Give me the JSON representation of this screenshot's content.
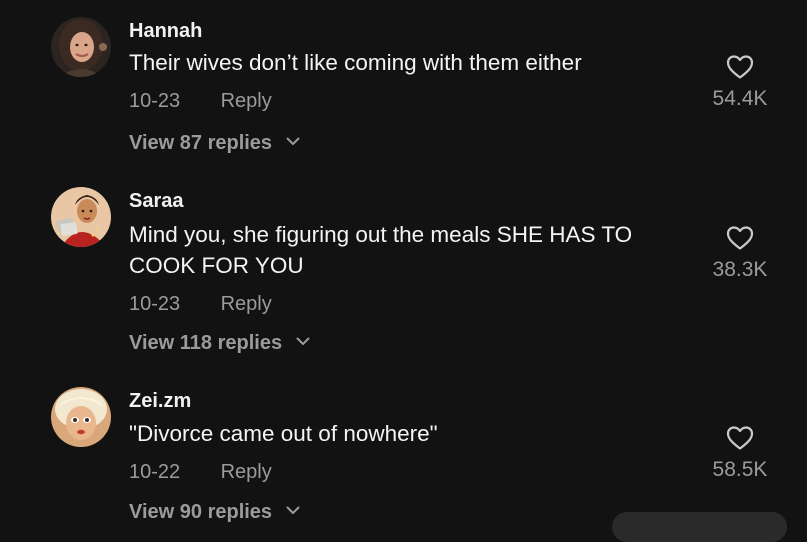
{
  "comments": [
    {
      "username": "Hannah",
      "text": "Their wives don’t like coming with them either",
      "date": "10-23",
      "reply_label": "Reply",
      "likes": "54.4K",
      "view_replies": "View 87 replies",
      "avatar_icon": "woman-portrait-avatar"
    },
    {
      "username": "Saraa",
      "text": "Mind you, she figuring out the meals SHE HAS TO COOK FOR YOU",
      "date": "10-23",
      "reply_label": "Reply",
      "likes": "38.3K",
      "view_replies": "View 118 replies",
      "avatar_icon": "illustrated-woman-avatar"
    },
    {
      "username": "Zei.zm",
      "text": "\"Divorce came out of nowhere\"",
      "date": "10-22",
      "reply_label": "Reply",
      "likes": "58.5K",
      "view_replies": "View 90 replies",
      "avatar_icon": "doll-face-avatar"
    }
  ],
  "colors": {
    "background": "#121212",
    "primary_text": "#f4f4f4",
    "secondary_text": "#9b9b9b"
  }
}
